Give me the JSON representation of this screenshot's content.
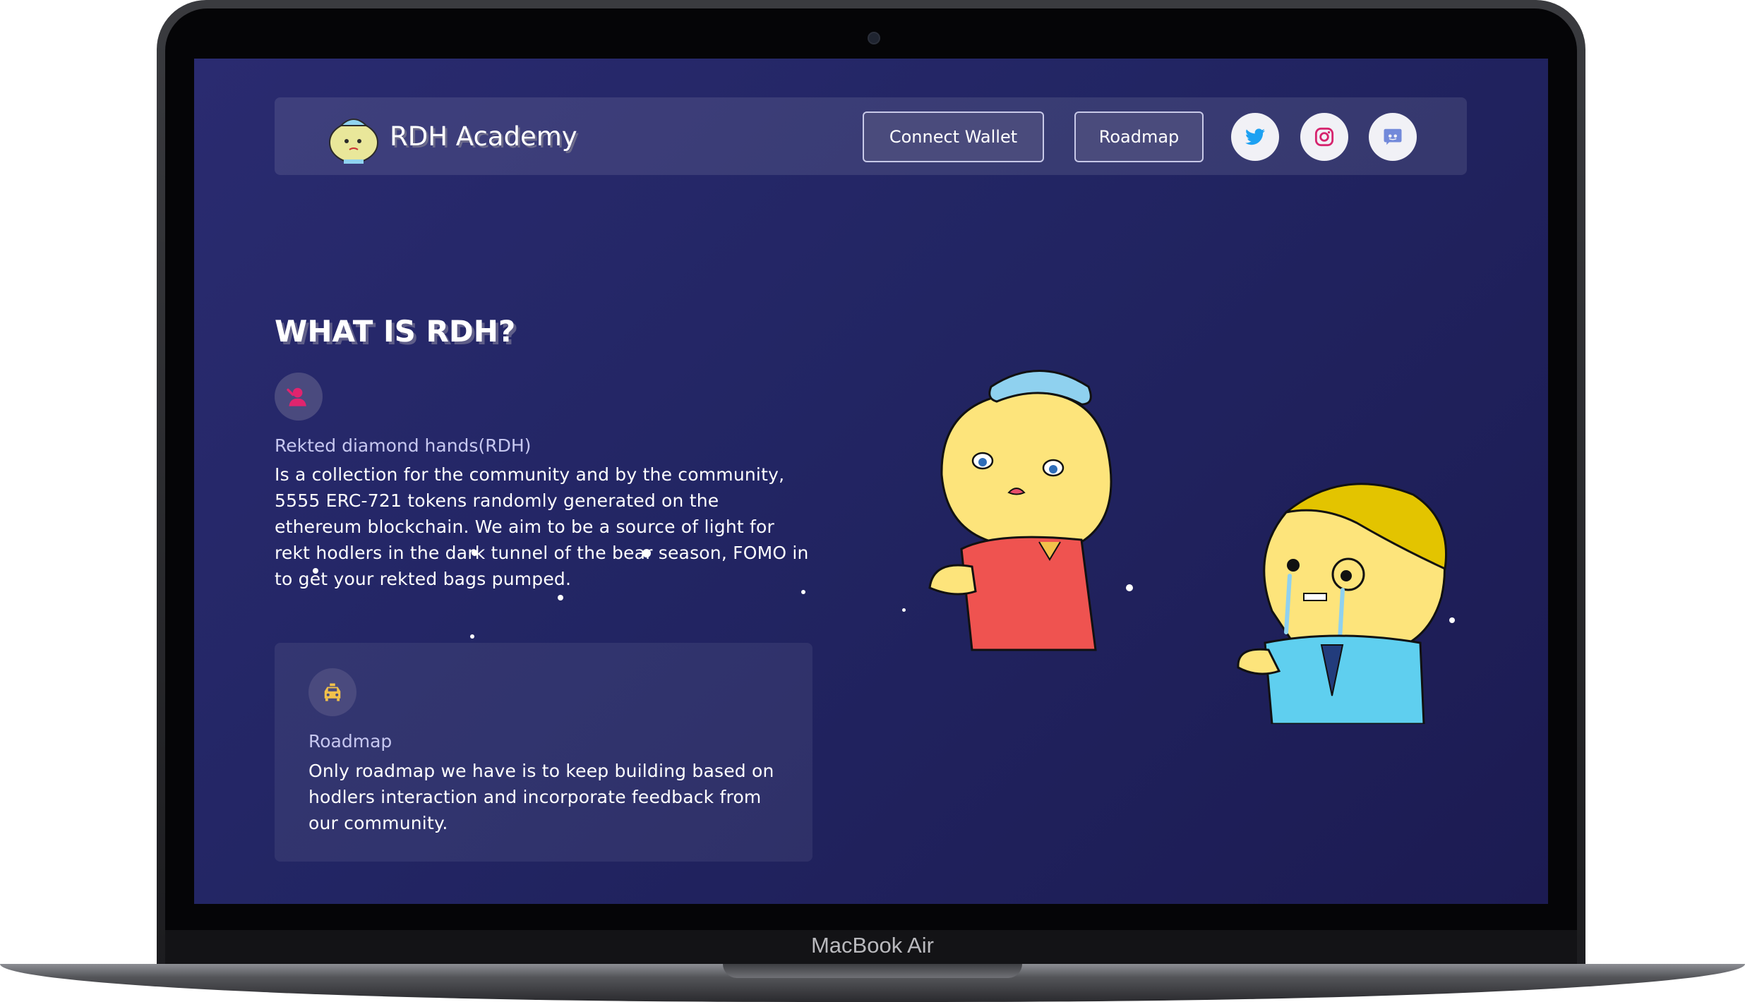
{
  "device": {
    "label": "MacBook Air"
  },
  "header": {
    "brand": "RDH Academy",
    "connect_wallet": "Connect Wallet",
    "roadmap": "Roadmap",
    "socials": [
      "twitter-icon",
      "instagram-icon",
      "discord-icon"
    ]
  },
  "main": {
    "title": "WHAT IS RDH?",
    "rdh": {
      "icon": "user-icon",
      "subtitle": "Rekted diamond hands(RDH)",
      "text": "Is a collection for the community and by the community, 5555 ERC-721 tokens randomly generated on the ethereum blockchain. We aim to be a source of light for rekt hodlers in the dark tunnel of the bear season, FOMO in to get your rekted bags pumped."
    },
    "roadmap": {
      "icon": "taxi-icon",
      "subtitle": "Roadmap",
      "text": "Only roadmap we have is to keep building based on hodlers interaction and incorporate feedback from our community."
    }
  },
  "colors": {
    "background": "#24266a",
    "accent_pink": "#e0246e",
    "accent_yellow": "#f2c14b",
    "twitter": "#1da1f2",
    "instagram": "#d6246e",
    "discord": "#7289da"
  }
}
